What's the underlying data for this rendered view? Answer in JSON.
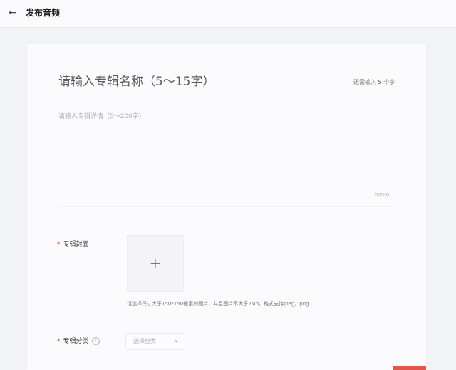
{
  "header": {
    "back_icon": "arrow-left-icon",
    "title": "发布音频",
    "title_suffix": "·"
  },
  "form": {
    "album_name": {
      "placeholder": "请输入专辑名称（5～15字）",
      "remaining_prefix": "还需输入",
      "remaining_count": "5",
      "remaining_suffix": "个字"
    },
    "album_detail": {
      "placeholder": "请输入专辑详情（5～200字）",
      "counter": "0/200"
    },
    "cover": {
      "required_mark": "*",
      "label": "专辑封面",
      "upload_icon": "plus-icon",
      "hint": "请选择尺寸大于150*150像素的图片，并且图片不大于2Mb，格式支持jpeg，png"
    },
    "category": {
      "required_mark": "*",
      "label": "专辑分类",
      "help_icon": "question-circle-icon",
      "help_glyph": "?",
      "select_placeholder": "选择分类"
    }
  },
  "colors": {
    "accent": "#e4564c",
    "background": "#f2f3f6",
    "card": "#fbfbfe"
  }
}
